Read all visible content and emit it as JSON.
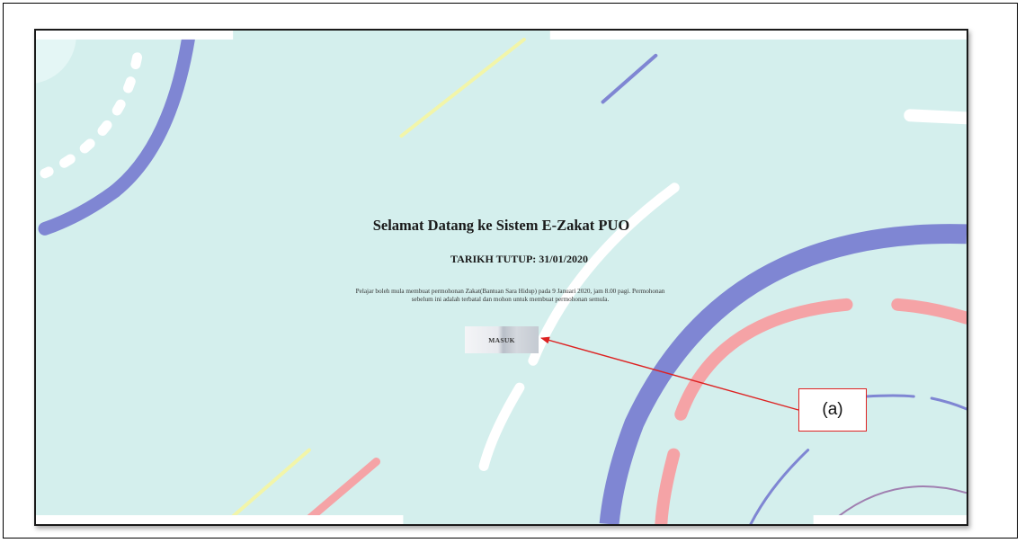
{
  "page": {
    "title": "Selamat Datang ke Sistem E-Zakat PUO",
    "closing_date": "TARIKH TUTUP: 31/01/2020",
    "description": "Pelajar boleh mula membuat permohonan Zakat(Bantuan Sara Hidup) pada 9 Januari 2020, jam 8.00 pagi. Permohonan sebelum ini adalah terbatal dan mohon untuk membuat permohonan semula.",
    "enter_button_label": "MASUK"
  },
  "annotation": {
    "callout_label": "(a)",
    "color": "#dd2222"
  },
  "colors": {
    "background": "#d4efed",
    "arc_blue": "#7f86d3",
    "arc_pink": "#f5a3a6",
    "line_yellow": "#f2f5a9",
    "line_white": "#ffffff"
  }
}
